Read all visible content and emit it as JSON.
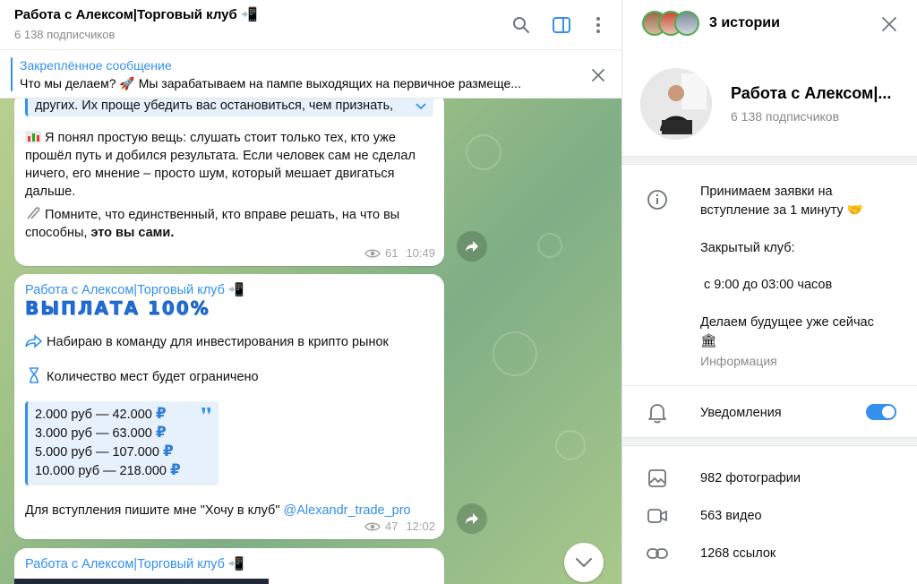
{
  "chat": {
    "title": "Работа с Алексом|Торговый клуб 📲",
    "subscribers": "6 138 подписчиков",
    "pinned": {
      "label": "Закреплённое сообщение",
      "text": "Что мы делаем? 🚀 Мы зарабатываем на пампе выходящих на первичное размеще..."
    }
  },
  "messages": [
    {
      "quote_tail": "других. Их проще убедить вас остановиться, чем признать,",
      "para1": "Я понял простую вещь: слушать стоит только тех, кто уже прошёл путь и добился результата. Если человек сам не сделал ничего, его мнение – просто шум, который мешает двигаться дальше.",
      "para2_pre": "Помните, что единственный, кто вправе решать, на что вы способны,",
      "para2_bold": "это вы сами.",
      "views": "61",
      "time": "10:49"
    },
    {
      "author": "Работа с Алексом|Торговый клуб 📲",
      "headline": "ВЫПЛАТА 100%",
      "line1": "Набираю в команду для инвестирования в крипто рынок",
      "line2": "Количество мест будет ограничено",
      "prices": [
        {
          "text": "2.000 руб — 42.000",
          "currency": "₽"
        },
        {
          "text": "3.000 руб — 63.000",
          "currency": "₽"
        },
        {
          "text": "5.000 руб — 107.000",
          "currency": "₽"
        },
        {
          "text": "10.000 руб — 218.000",
          "currency": "₽"
        }
      ],
      "cta": "Для вступления пишите мне \"Хочу в клуб\"",
      "cta_link": "@Alexandr_trade_pro",
      "views": "47",
      "time": "12:02"
    },
    {
      "author": "Работа с Алексом|Торговый клуб 📲"
    }
  ],
  "info": {
    "stories": "3 истории",
    "title": "Работа с Алексом|...",
    "subscribers": "6 138 подписчиков",
    "description": {
      "line1": "Принимаем заявки на",
      "line2": "вступление за 1 минуту 🤝",
      "line3": "Закрытый клуб:",
      "line4": "с 9:00 до 03:00 часов",
      "line5": "Делаем будущее уже сейчас",
      "line6": "🏛",
      "label": "Информация"
    },
    "notifications": "Уведомления",
    "notifications_on": true,
    "media": [
      {
        "icon": "photo-icon",
        "text": "982 фотографии"
      },
      {
        "icon": "video-icon",
        "text": "563 видео"
      },
      {
        "icon": "link-icon",
        "text": "1268 ссылок"
      }
    ]
  },
  "colors": {
    "accent": "#3390ec",
    "wallpaper": "#9cbf86"
  }
}
